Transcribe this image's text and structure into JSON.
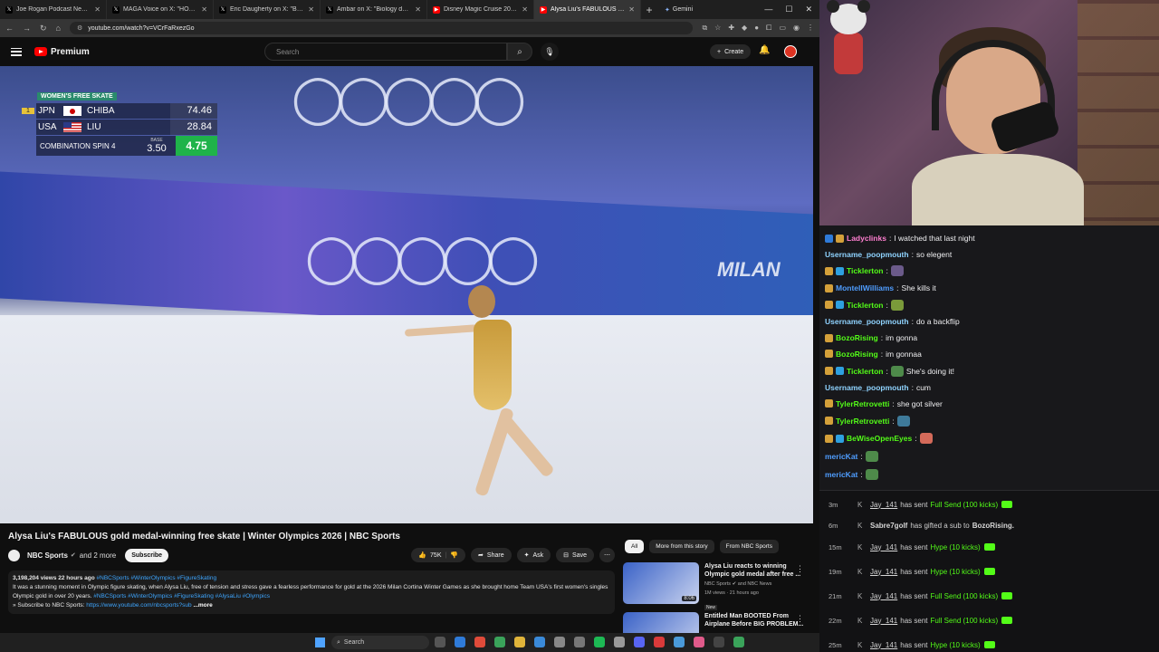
{
  "browser": {
    "tabs": [
      {
        "title": "Joe Rogan Podcast News on X",
        "favicon": "x-icon",
        "active": false
      },
      {
        "title": "MAGA Voice on X: \"HOLY SH",
        "favicon": "x-icon",
        "active": false
      },
      {
        "title": "Eric Daugherty on X: \"BREA",
        "favicon": "x-icon",
        "active": false
      },
      {
        "title": "Ambar on X: \"Biology doesn't",
        "favicon": "x-icon",
        "active": false
      },
      {
        "title": "Disney Magic Cruise 2026 | 5-",
        "favicon": "youtube-icon",
        "active": false
      },
      {
        "title": "Alysa Liu's FABULOUS gold",
        "favicon": "youtube-icon",
        "active": true
      }
    ],
    "gemini_label": "Gemini",
    "url": "youtube.com/watch?v=VCrFaRxezGo"
  },
  "youtube": {
    "logo_text": "Premium",
    "search_placeholder": "Search",
    "create_label": "Create"
  },
  "scoreboard": {
    "title": "WOMEN'S FREE SKATE",
    "rows": [
      {
        "rank": "1",
        "country": "JPN",
        "name": "CHIBA",
        "score": "74.46"
      },
      {
        "rank": "",
        "country": "USA",
        "name": "LIU",
        "score": "28.84"
      }
    ],
    "element": {
      "name": "COMBINATION SPIN 4",
      "base_label": "BASE",
      "base": "3.50",
      "total": "4.75"
    }
  },
  "video_overlay": {
    "milano_text": "MILAN"
  },
  "video_info": {
    "title": "Alysa Liu's FABULOUS gold medal-winning free skate | Winter Olympics 2026 | NBC Sports",
    "channel": "NBC Sports",
    "channel_more": "and 2 more",
    "subscribe_label": "Subscribe",
    "likes": "75K",
    "share_label": "Share",
    "ask_label": "Ask",
    "save_label": "Save",
    "views_meta": "3,198,204 views  22 hours ago",
    "meta_tags": "#NBCSports #WinterOlympics #FigureSkating",
    "description": "It was a stunning moment in Olympic figure skating, when Alysa Liu, free of tension and stress gave a fearless performance for gold at the 2026 Milan Cortina Winter Games as she brought home Team USA's first women's singles Olympic gold in over 20 years.",
    "desc_tags": "#NBCSports #WinterOlympics #FigureSkating #AlysaLiu #Olympics",
    "subscribe_line": "» Subscribe to NBC Sports: ",
    "subscribe_link": "https://www.youtube.com/nbcsports?sub",
    "more_label": "...more"
  },
  "related": {
    "chips": [
      "All",
      "More from this story",
      "From NBC Sports"
    ],
    "items": [
      {
        "title": "Alysa Liu reacts to winning Olympic gold medal after free ...",
        "channel": "NBC Sports",
        "channel_more": "and NBC News",
        "meta": "1M views · 21 hours ago",
        "badge": "New",
        "duration": "8:06"
      },
      {
        "title": "Entitled Man BOOTED From Airplane Before BIG PROBLEM...",
        "channel": "",
        "channel_more": "",
        "meta": "",
        "badge": "",
        "duration": ""
      }
    ]
  },
  "chat": [
    {
      "user": "Ladyclinks",
      "color": "#ff7fd0",
      "text": "I watched that last night",
      "badges": [
        "#2f7bd9",
        "#d4a03a"
      ],
      "emote": ""
    },
    {
      "user": "Username_poopmouth",
      "color": "#8fd3ff",
      "text": "so elegent",
      "badges": [],
      "emote": ""
    },
    {
      "user": "Ticklerton",
      "color": "#53fc18",
      "text": "",
      "badges": [
        "#d4a03a",
        "#2ea0e0"
      ],
      "emote": "#6b5a8a"
    },
    {
      "user": "MontellWilliams",
      "color": "#4f9dff",
      "text": "She kills it",
      "badges": [
        "#d4a03a"
      ],
      "emote": ""
    },
    {
      "user": "Ticklerton",
      "color": "#53fc18",
      "text": "",
      "badges": [
        "#d4a03a",
        "#2ea0e0"
      ],
      "emote": "#7a9a3a"
    },
    {
      "user": "Username_poopmouth",
      "color": "#8fd3ff",
      "text": "do a backflip",
      "badges": [],
      "emote": ""
    },
    {
      "user": "BozoRising",
      "color": "#53fc18",
      "text": "im gonna",
      "badges": [
        "#d4a03a"
      ],
      "emote": ""
    },
    {
      "user": "BozoRising",
      "color": "#53fc18",
      "text": "im gonnaa",
      "badges": [
        "#d4a03a"
      ],
      "emote": ""
    },
    {
      "user": "Ticklerton",
      "color": "#53fc18",
      "text": "She's doing it!",
      "badges": [
        "#d4a03a",
        "#2ea0e0"
      ],
      "emote": "#4e8a4a"
    },
    {
      "user": "Username_poopmouth",
      "color": "#8fd3ff",
      "text": "cum",
      "badges": [],
      "emote": ""
    },
    {
      "user": "TylerRetrovetti",
      "color": "#53fc18",
      "text": "she got silver",
      "badges": [
        "#d4a03a"
      ],
      "emote": ""
    },
    {
      "user": "TylerRetrovetti",
      "color": "#53fc18",
      "text": "",
      "badges": [
        "#d4a03a"
      ],
      "emote": "#3e7a9a"
    },
    {
      "user": "BeWiseOpenEyes",
      "color": "#53fc18",
      "text": "",
      "badges": [
        "#d4a03a",
        "#2ea0e0"
      ],
      "emote": "#d46a5a"
    },
    {
      "user": "mericKat",
      "color": "#4f9dff",
      "text": "",
      "badges": [],
      "emote": "#4e8a4a"
    },
    {
      "user": "mericKat",
      "color": "#4f9dff",
      "text": "",
      "badges": [],
      "emote": "#4e8a4a"
    }
  ],
  "events": [
    {
      "ago": "3m",
      "user": "Jay_141",
      "mid": "has sent",
      "kick": "Full Send (100 kicks)",
      "type": "kicks"
    },
    {
      "ago": "6m",
      "user": "Sabre7golf",
      "mid": "has gifted a sub to",
      "kick": "BozoRising.",
      "type": "gift"
    },
    {
      "ago": "15m",
      "user": "Jay_141",
      "mid": "has sent",
      "kick": "Hype (10 kicks)",
      "type": "kicks"
    },
    {
      "ago": "19m",
      "user": "Jay_141",
      "mid": "has sent",
      "kick": "Hype (10 kicks)",
      "type": "kicks"
    },
    {
      "ago": "21m",
      "user": "Jay_141",
      "mid": "has sent",
      "kick": "Full Send (100 kicks)",
      "type": "kicks"
    },
    {
      "ago": "22m",
      "user": "Jay_141",
      "mid": "has sent",
      "kick": "Full Send (100 kicks)",
      "type": "kicks"
    },
    {
      "ago": "25m",
      "user": "Jay_141",
      "mid": "has sent",
      "kick": "Hype (10 kicks)",
      "type": "kicks"
    }
  ],
  "taskbar": {
    "search_placeholder": "Search"
  }
}
